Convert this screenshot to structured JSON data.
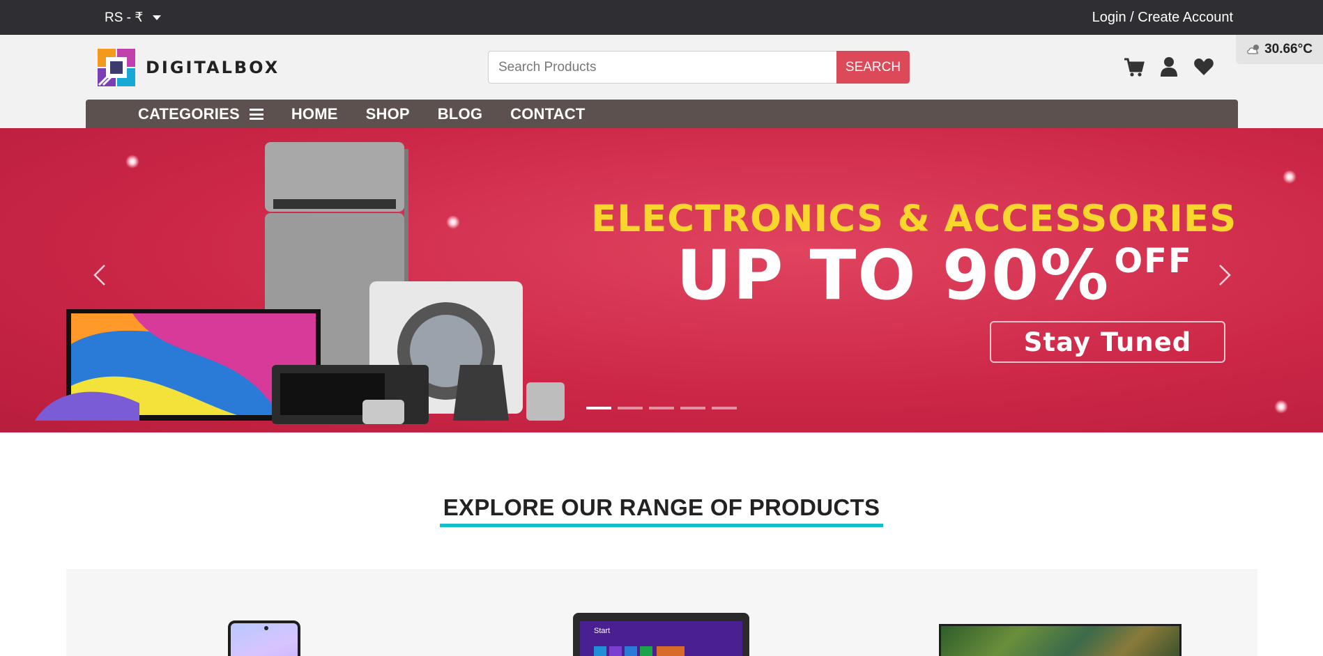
{
  "topbar": {
    "currency": "RS - ₹",
    "login": "Login / Create Account"
  },
  "header": {
    "logo_text": "DIGITALBOX",
    "search_placeholder": "Search Products",
    "search_button": "SEARCH",
    "weather": "30.66°C"
  },
  "nav": {
    "items": [
      {
        "label": "CATEGORIES"
      },
      {
        "label": "HOME"
      },
      {
        "label": "SHOP"
      },
      {
        "label": "BLOG"
      },
      {
        "label": "CONTACT"
      }
    ]
  },
  "banner": {
    "headline": "ELECTRONICS & ACCESSORIES",
    "offer_main": "UP TO 90%",
    "offer_suffix": "OFF",
    "cta": "Stay Tuned",
    "slide_count": 5,
    "active_slide": 1
  },
  "section": {
    "title": "EXPLORE OUR RANGE OF PRODUCTS"
  },
  "laptop_screen": {
    "start_label": "Start"
  },
  "colors": {
    "topbar": "#2f2e33",
    "nav": "#5d514f",
    "search_button": "#dc4a5a",
    "banner": "#cc2747",
    "headline": "#f8d62e",
    "title_underline": "#13c0c8"
  },
  "icons": [
    "chevron-down-icon",
    "cart-icon",
    "user-icon",
    "heart-icon",
    "cloud-icon",
    "hamburger-icon",
    "chevron-left-icon",
    "chevron-right-icon"
  ]
}
